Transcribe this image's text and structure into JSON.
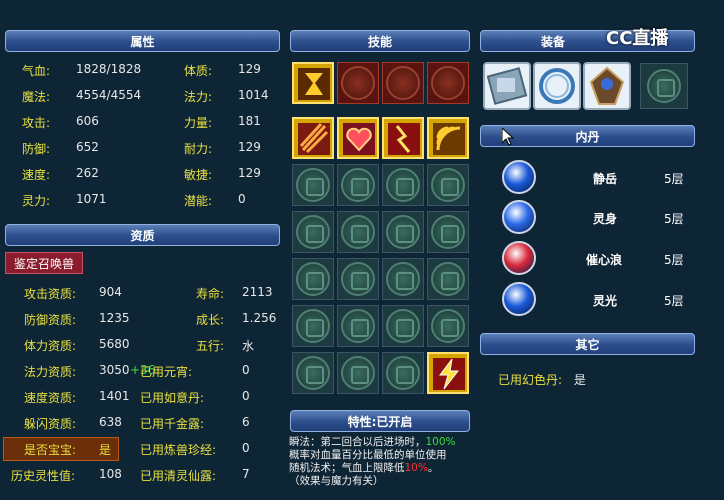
{
  "headers": {
    "attributes": "属性",
    "skills": "技能",
    "equipment": "装备",
    "inner_pill": "内丹",
    "aptitude": "资质",
    "other": "其它",
    "trait": "特性:已开启"
  },
  "logo": "CC直播",
  "attributes": [
    {
      "label": "气血:",
      "value": "1828/1828",
      "label2": "体质:",
      "value2": "129"
    },
    {
      "label": "魔法:",
      "value": "4554/4554",
      "label2": "法力:",
      "value2": "1014"
    },
    {
      "label": "攻击:",
      "value": "606",
      "label2": "力量:",
      "value2": "181"
    },
    {
      "label": "防御:",
      "value": "652",
      "label2": "耐力:",
      "value2": "129"
    },
    {
      "label": "速度:",
      "value": "262",
      "label2": "敏捷:",
      "value2": "129"
    },
    {
      "label": "灵力:",
      "value": "1071",
      "label2": "潜能:",
      "value2": "0"
    }
  ],
  "identify_button": "鉴定召唤兽",
  "aptitudes": [
    {
      "label": "攻击资质:",
      "value": "904",
      "bonus": "",
      "label2": "寿命:",
      "value2": "2113"
    },
    {
      "label": "防御资质:",
      "value": "1235",
      "bonus": "",
      "label2": "成长:",
      "value2": "1.256"
    },
    {
      "label": "体力资质:",
      "value": "5680",
      "bonus": "",
      "label2": "五行:",
      "value2": "水"
    },
    {
      "label": "法力资质:",
      "value": "3050",
      "bonus": "+36",
      "label2": "已用元宵:",
      "value2": "0"
    },
    {
      "label": "速度资质:",
      "value": "1401",
      "bonus": "",
      "label2": "已用如意丹:",
      "value2": "0"
    },
    {
      "label": "躲闪资质:",
      "value": "638",
      "bonus": "",
      "label2": "已用千金露:",
      "value2": "6"
    },
    {
      "label": "是否宝宝:",
      "value": "是",
      "bonus": "",
      "label2": "已用炼兽珍经:",
      "value2": "0"
    },
    {
      "label": "历史灵性值:",
      "value": "108",
      "bonus": "",
      "label2": "已用清灵仙露:",
      "value2": "7"
    }
  ],
  "inner_pills": [
    {
      "name": "静岳",
      "level": "5层",
      "color": "#1a5ad8"
    },
    {
      "name": "灵身",
      "level": "5层",
      "color": "#2a6ae8"
    },
    {
      "name": "催心浪",
      "level": "5层",
      "color": "#d82a3a"
    },
    {
      "name": "灵光",
      "level": "5层",
      "color": "#1a5ad8"
    }
  ],
  "other": {
    "label": "已用幻色丹:",
    "value": "是"
  },
  "trait": {
    "line1": "瞬法：第二回合以后进场时，",
    "pct1": "100%",
    "line2": "概率对血量百分比最低的单位使用",
    "line3": "随机法术；气血上限降低",
    "pct2": "10%",
    "line3_end": "。",
    "line4": "（效果与魔力有关）"
  }
}
